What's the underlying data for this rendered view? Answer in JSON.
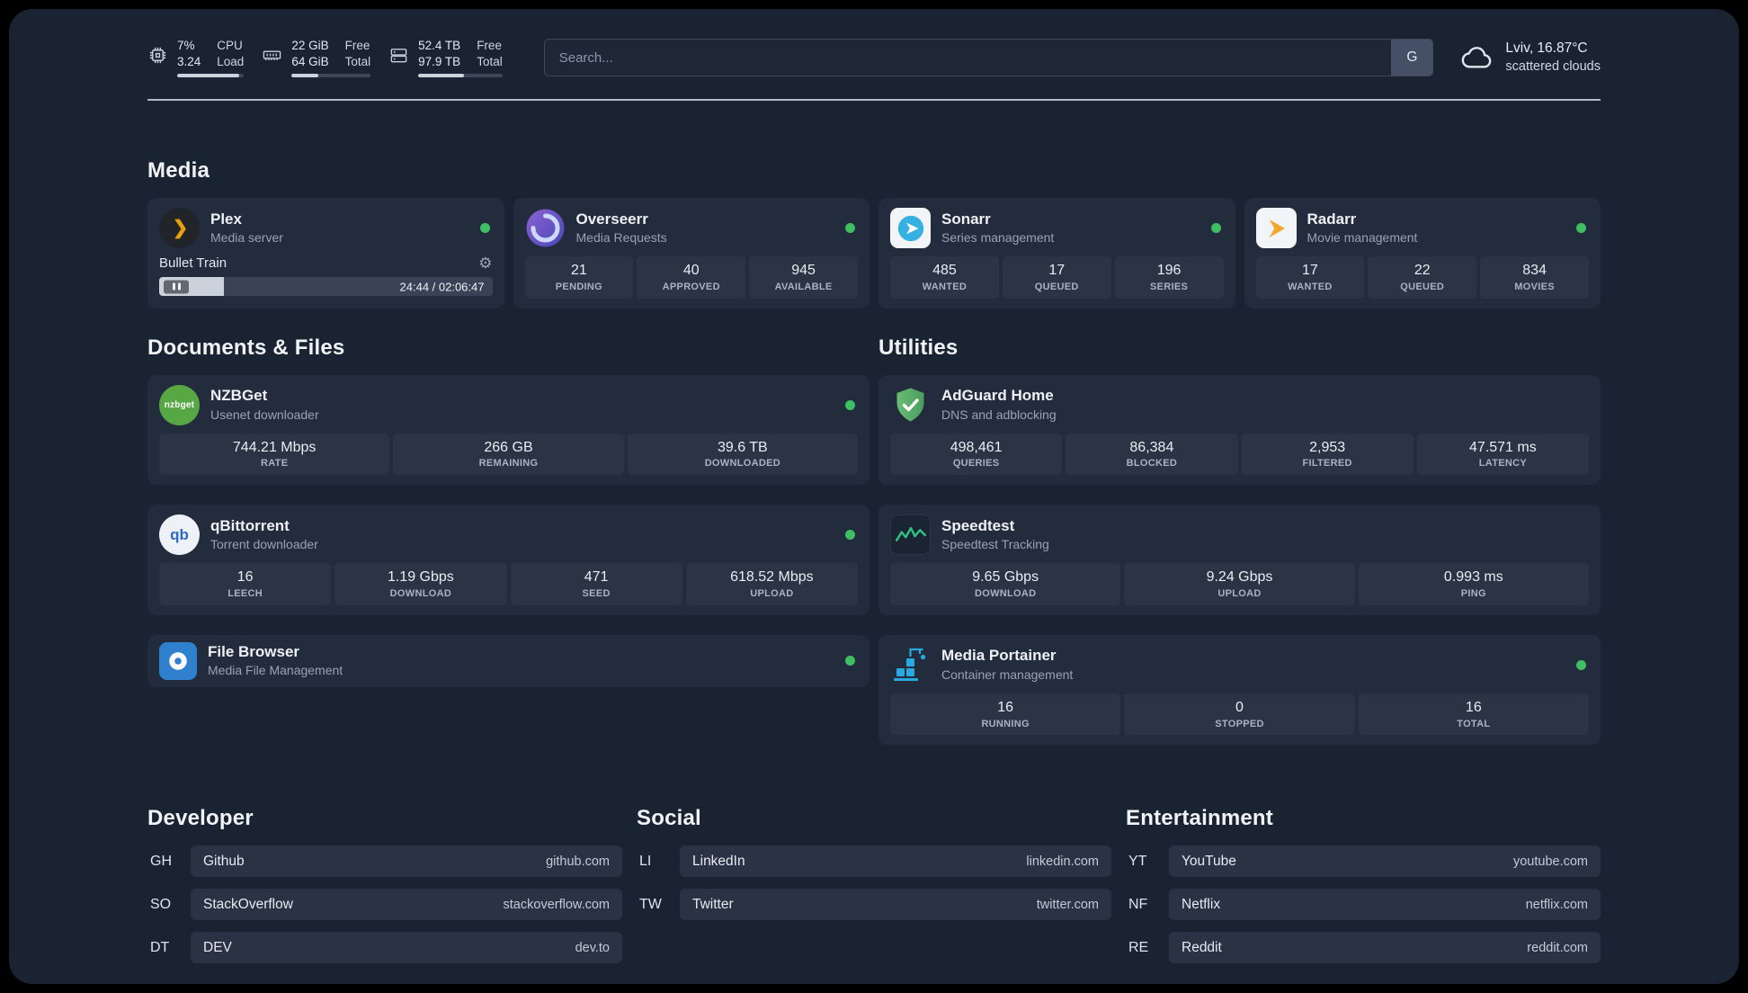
{
  "colors": {
    "accent_green": "#3fbe63",
    "panel_bg": "#1a2332",
    "card_bg": "#232c3d",
    "tile_bg": "#2b3445"
  },
  "topbar": {
    "cpu": {
      "value_top": "7%",
      "value_bottom": "3.24",
      "label_top": "CPU",
      "label_bottom": "Load",
      "bar_percent": 93
    },
    "ram": {
      "value_top": "22 GiB",
      "value_bottom": "64 GiB",
      "label_top": "Free",
      "label_bottom": "Total",
      "bar_percent": 34
    },
    "disk": {
      "value_top": "52.4 TB",
      "value_bottom": "97.9 TB",
      "label_top": "Free",
      "label_bottom": "Total",
      "bar_percent": 54
    },
    "search": {
      "placeholder": "Search...",
      "engine_label": "G"
    },
    "weather": {
      "location": "Lviv, 16.87°C",
      "condition": "scattered clouds"
    }
  },
  "media": {
    "title": "Media",
    "plex": {
      "name": "Plex",
      "subtitle": "Media server",
      "now_playing": "Bullet Train",
      "time": "24:44 / 02:06:47",
      "progress_percent": 19.5
    },
    "overseerr": {
      "name": "Overseerr",
      "subtitle": "Media Requests",
      "stats": [
        {
          "value": "21",
          "label": "PENDING"
        },
        {
          "value": "40",
          "label": "APPROVED"
        },
        {
          "value": "945",
          "label": "AVAILABLE"
        }
      ]
    },
    "sonarr": {
      "name": "Sonarr",
      "subtitle": "Series management",
      "stats": [
        {
          "value": "485",
          "label": "WANTED"
        },
        {
          "value": "17",
          "label": "QUEUED"
        },
        {
          "value": "196",
          "label": "SERIES"
        }
      ]
    },
    "radarr": {
      "name": "Radarr",
      "subtitle": "Movie management",
      "stats": [
        {
          "value": "17",
          "label": "WANTED"
        },
        {
          "value": "22",
          "label": "QUEUED"
        },
        {
          "value": "834",
          "label": "MOVIES"
        }
      ]
    }
  },
  "documents": {
    "title": "Documents & Files",
    "nzbget": {
      "name": "NZBGet",
      "subtitle": "Usenet downloader",
      "stats": [
        {
          "value": "744.21 Mbps",
          "label": "RATE"
        },
        {
          "value": "266 GB",
          "label": "REMAINING"
        },
        {
          "value": "39.6 TB",
          "label": "DOWNLOADED"
        }
      ]
    },
    "qbittorrent": {
      "name": "qBittorrent",
      "subtitle": "Torrent downloader",
      "stats": [
        {
          "value": "16",
          "label": "LEECH"
        },
        {
          "value": "1.19 Gbps",
          "label": "DOWNLOAD"
        },
        {
          "value": "471",
          "label": "SEED"
        },
        {
          "value": "618.52 Mbps",
          "label": "UPLOAD"
        }
      ]
    },
    "filebrowser": {
      "name": "File Browser",
      "subtitle": "Media File Management"
    }
  },
  "utilities": {
    "title": "Utilities",
    "adguard": {
      "name": "AdGuard Home",
      "subtitle": "DNS and adblocking",
      "stats": [
        {
          "value": "498,461",
          "label": "QUERIES"
        },
        {
          "value": "86,384",
          "label": "BLOCKED"
        },
        {
          "value": "2,953",
          "label": "FILTERED"
        },
        {
          "value": "47.571 ms",
          "label": "LATENCY"
        }
      ]
    },
    "speedtest": {
      "name": "Speedtest",
      "subtitle": "Speedtest Tracking",
      "stats": [
        {
          "value": "9.65 Gbps",
          "label": "DOWNLOAD"
        },
        {
          "value": "9.24 Gbps",
          "label": "UPLOAD"
        },
        {
          "value": "0.993 ms",
          "label": "PING"
        }
      ]
    },
    "portainer": {
      "name": "Media Portainer",
      "subtitle": "Container management",
      "stats": [
        {
          "value": "16",
          "label": "RUNNING"
        },
        {
          "value": "0",
          "label": "STOPPED"
        },
        {
          "value": "16",
          "label": "TOTAL"
        }
      ]
    }
  },
  "bookmarks": {
    "developer": {
      "title": "Developer",
      "items": [
        {
          "abbr": "GH",
          "name": "Github",
          "url": "github.com"
        },
        {
          "abbr": "SO",
          "name": "StackOverflow",
          "url": "stackoverflow.com"
        },
        {
          "abbr": "DT",
          "name": "DEV",
          "url": "dev.to"
        }
      ]
    },
    "social": {
      "title": "Social",
      "items": [
        {
          "abbr": "LI",
          "name": "LinkedIn",
          "url": "linkedin.com"
        },
        {
          "abbr": "TW",
          "name": "Twitter",
          "url": "twitter.com"
        }
      ]
    },
    "entertainment": {
      "title": "Entertainment",
      "items": [
        {
          "abbr": "YT",
          "name": "YouTube",
          "url": "youtube.com"
        },
        {
          "abbr": "NF",
          "name": "Netflix",
          "url": "netflix.com"
        },
        {
          "abbr": "RE",
          "name": "Reddit",
          "url": "reddit.com"
        }
      ]
    }
  }
}
